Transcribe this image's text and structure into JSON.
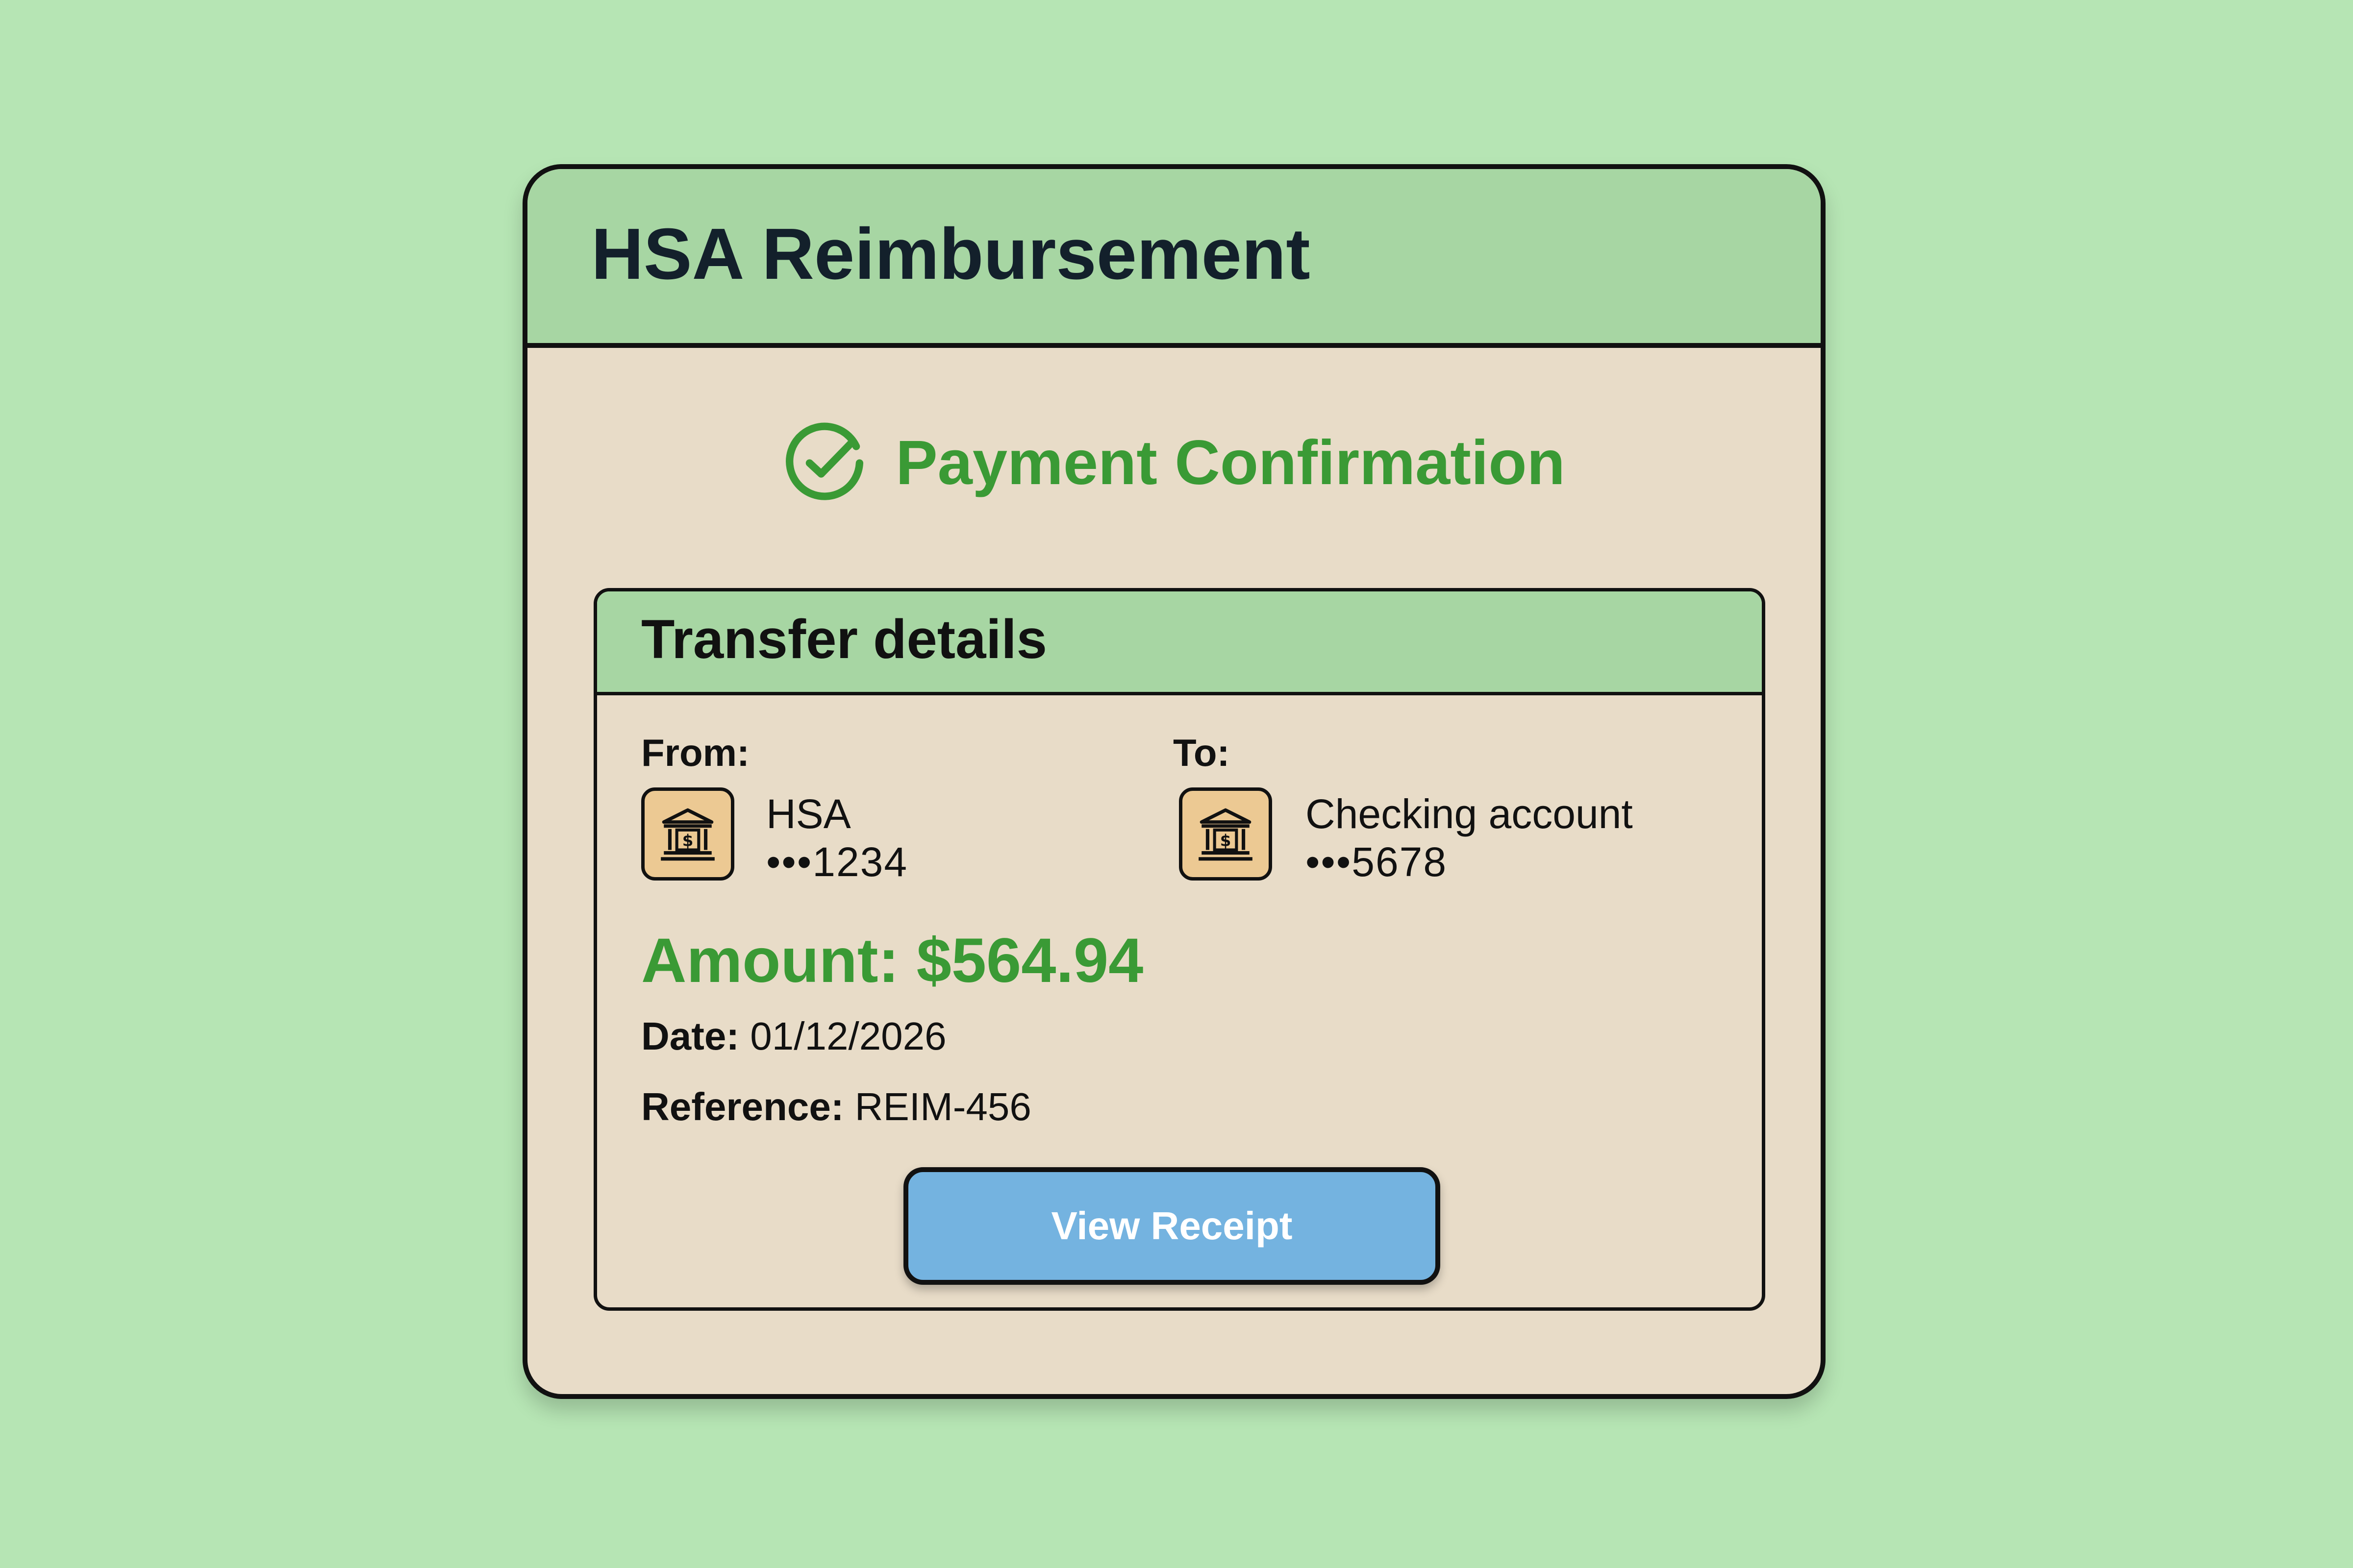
{
  "card": {
    "title": "HSA Reimbursement"
  },
  "confirmation": {
    "icon": "check-circle-icon",
    "text": "Payment Confirmation",
    "color": "#3a9a35"
  },
  "transfer": {
    "title": "Transfer details",
    "from": {
      "label": "From:",
      "icon": "bank-icon",
      "name": "HSA",
      "number": "•••1234"
    },
    "to": {
      "label": "To:",
      "icon": "bank-icon",
      "name": "Checking account",
      "number": "•••5678"
    },
    "amount": "Amount: $564.94",
    "date": {
      "label": "Date:",
      "value": "01/12/2026"
    },
    "reference": {
      "label": "Reference:",
      "value": "REIM-456"
    },
    "button_label": "View Receipt"
  },
  "colors": {
    "background": "#b6e5b4",
    "header": "#a7d6a3",
    "card_body": "#e8dcc8",
    "button": "#74b3e0",
    "accent_green": "#3a9a35"
  }
}
